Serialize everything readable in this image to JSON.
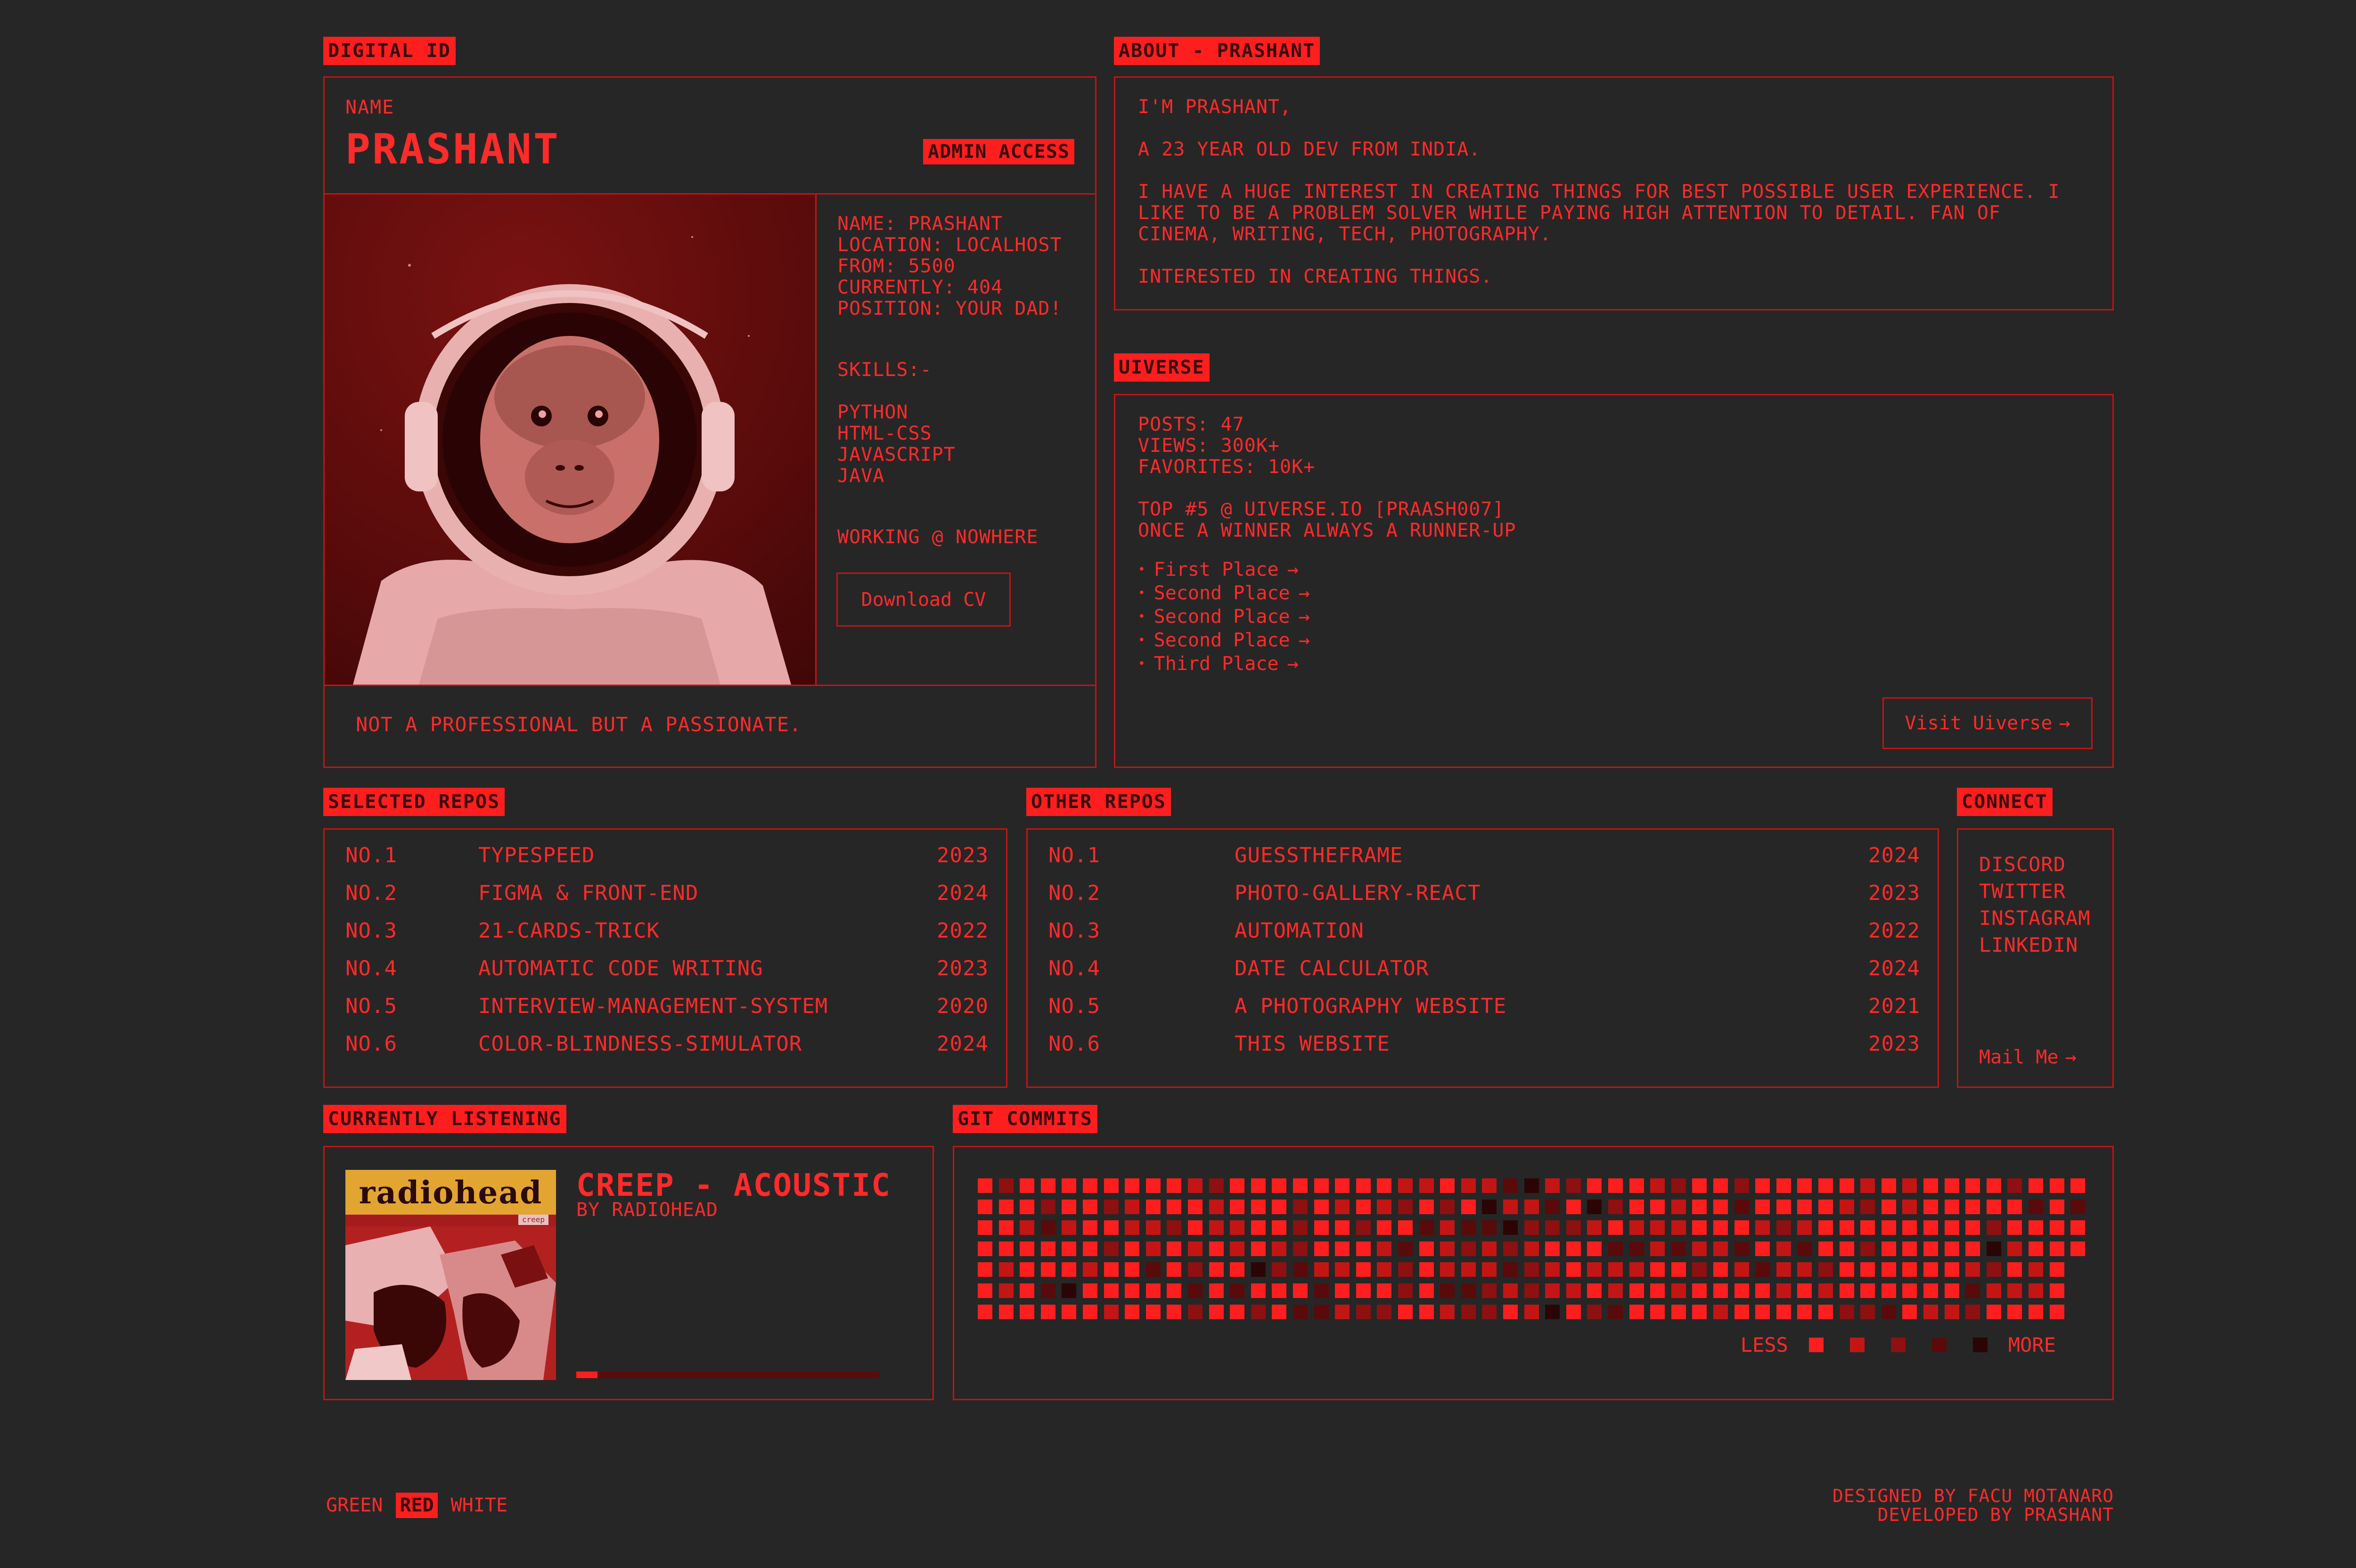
{
  "digital_id": {
    "section_label": "DIGITAL ID",
    "name_label": "NAME",
    "name": "PRASHANT",
    "admin_badge": "ADMIN ACCESS",
    "details": [
      "NAME: PRASHANT",
      "LOCATION: LOCALHOST",
      "FROM: 5500",
      "CURRENTLY: 404",
      "POSITION: YOUR DAD!"
    ],
    "skills_label": "SKILLS:-",
    "skills": [
      "PYTHON",
      "HTML-CSS",
      "JAVASCRIPT",
      "JAVA"
    ],
    "working": "WORKING @ NOWHERE",
    "download_cv": "Download CV",
    "tagline": "NOT A PROFESSIONAL BUT A PASSIONATE."
  },
  "about": {
    "section_label": "ABOUT - PRASHANT",
    "paragraphs": [
      "I'M PRASHANT,",
      "A 23 YEAR OLD DEV FROM INDIA.",
      "I HAVE A HUGE INTEREST IN CREATING THINGS FOR BEST POSSIBLE USER EXPERIENCE. I LIKE TO BE A PROBLEM SOLVER WHILE PAYING HIGH ATTENTION TO DETAIL. FAN OF CINEMA, WRITING, TECH, PHOTOGRAPHY.",
      "INTERESTED IN CREATING THINGS."
    ]
  },
  "uiverse": {
    "section_label": "UIVERSE",
    "stats": [
      "POSTS: 47",
      "VIEWS: 300K+",
      "FAVORITES: 10K+"
    ],
    "rank_lines": [
      "TOP #5 @ UIVERSE.IO [PRAASH007]",
      "ONCE A WINNER ALWAYS A RUNNER-UP"
    ],
    "places": [
      "First Place",
      "Second Place",
      "Second Place",
      "Second Place",
      "Third Place"
    ],
    "visit_label": "Visit Uiverse"
  },
  "selected_repos": {
    "section_label": "SELECTED REPOS",
    "rows": [
      {
        "no": "NO.1",
        "name": "TYPESPEED",
        "year": "2023"
      },
      {
        "no": "NO.2",
        "name": "FIGMA & FRONT-END",
        "year": "2024"
      },
      {
        "no": "NO.3",
        "name": "21-CARDS-TRICK",
        "year": "2022"
      },
      {
        "no": "NO.4",
        "name": "AUTOMATIC CODE WRITING",
        "year": "2023"
      },
      {
        "no": "NO.5",
        "name": "INTERVIEW-MANAGEMENT-SYSTEM",
        "year": "2020"
      },
      {
        "no": "NO.6",
        "name": "COLOR-BLINDNESS-SIMULATOR",
        "year": "2024"
      }
    ]
  },
  "other_repos": {
    "section_label": "OTHER REPOS",
    "rows": [
      {
        "no": "NO.1",
        "name": "GUESSTHEFRAME",
        "year": "2024"
      },
      {
        "no": "NO.2",
        "name": "PHOTO-GALLERY-REACT",
        "year": "2023"
      },
      {
        "no": "NO.3",
        "name": "AUTOMATION",
        "year": "2022"
      },
      {
        "no": "NO.4",
        "name": "DATE CALCULATOR",
        "year": "2024"
      },
      {
        "no": "NO.5",
        "name": "A PHOTOGRAPHY WEBSITE",
        "year": "2021"
      },
      {
        "no": "NO.6",
        "name": "THIS WEBSITE",
        "year": "2023"
      }
    ]
  },
  "connect": {
    "section_label": "CONNECT",
    "links": [
      "DISCORD",
      "TWITTER",
      "INSTAGRAM",
      "LINKEDIN"
    ],
    "mail_label": "Mail Me"
  },
  "listening": {
    "section_label": "CURRENTLY LISTENING",
    "album_logo": "radiohead",
    "album_sub": "creep",
    "title": "CREEP - ACOUSTIC",
    "artist": "BY RADIOHEAD",
    "progress": 0.07
  },
  "git_commits": {
    "section_label": "GIT COMMITS",
    "less_label": "LESS",
    "more_label": "MORE"
  },
  "footer": {
    "themes": [
      "GREEN",
      "RED",
      "WHITE"
    ],
    "active_theme": "RED",
    "credits": [
      "DESIGNED BY FACU MOTANARO",
      "DEVELOPED BY PRASHANT"
    ]
  },
  "colors": {
    "accent": "#ff1e1e",
    "background": "#262626",
    "border": "#c21414",
    "levels": [
      "#ff1e1e",
      "#c41515",
      "#8e1010",
      "#5a0a0a",
      "#2b0505"
    ]
  }
}
